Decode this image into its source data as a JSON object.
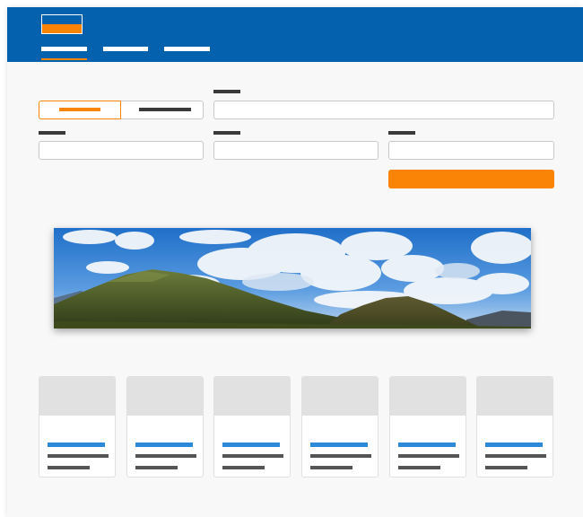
{
  "header": {
    "brand_colors": {
      "primary": "#0461ae",
      "accent": "#fa8406"
    },
    "logo": {
      "icon": "logo-icon"
    },
    "nav": {
      "items": [
        {
          "active": true
        },
        {
          "active": false
        },
        {
          "active": false
        }
      ]
    }
  },
  "form": {
    "segmented_control": {
      "options": [
        {
          "selected": true
        },
        {
          "selected": false
        }
      ]
    },
    "submit_button": {
      "color": "#fa8406"
    }
  },
  "banner": {
    "image": "mountain-landscape-image"
  },
  "cards": {
    "count_visible": 6,
    "title_color": "#2c8ad8"
  }
}
